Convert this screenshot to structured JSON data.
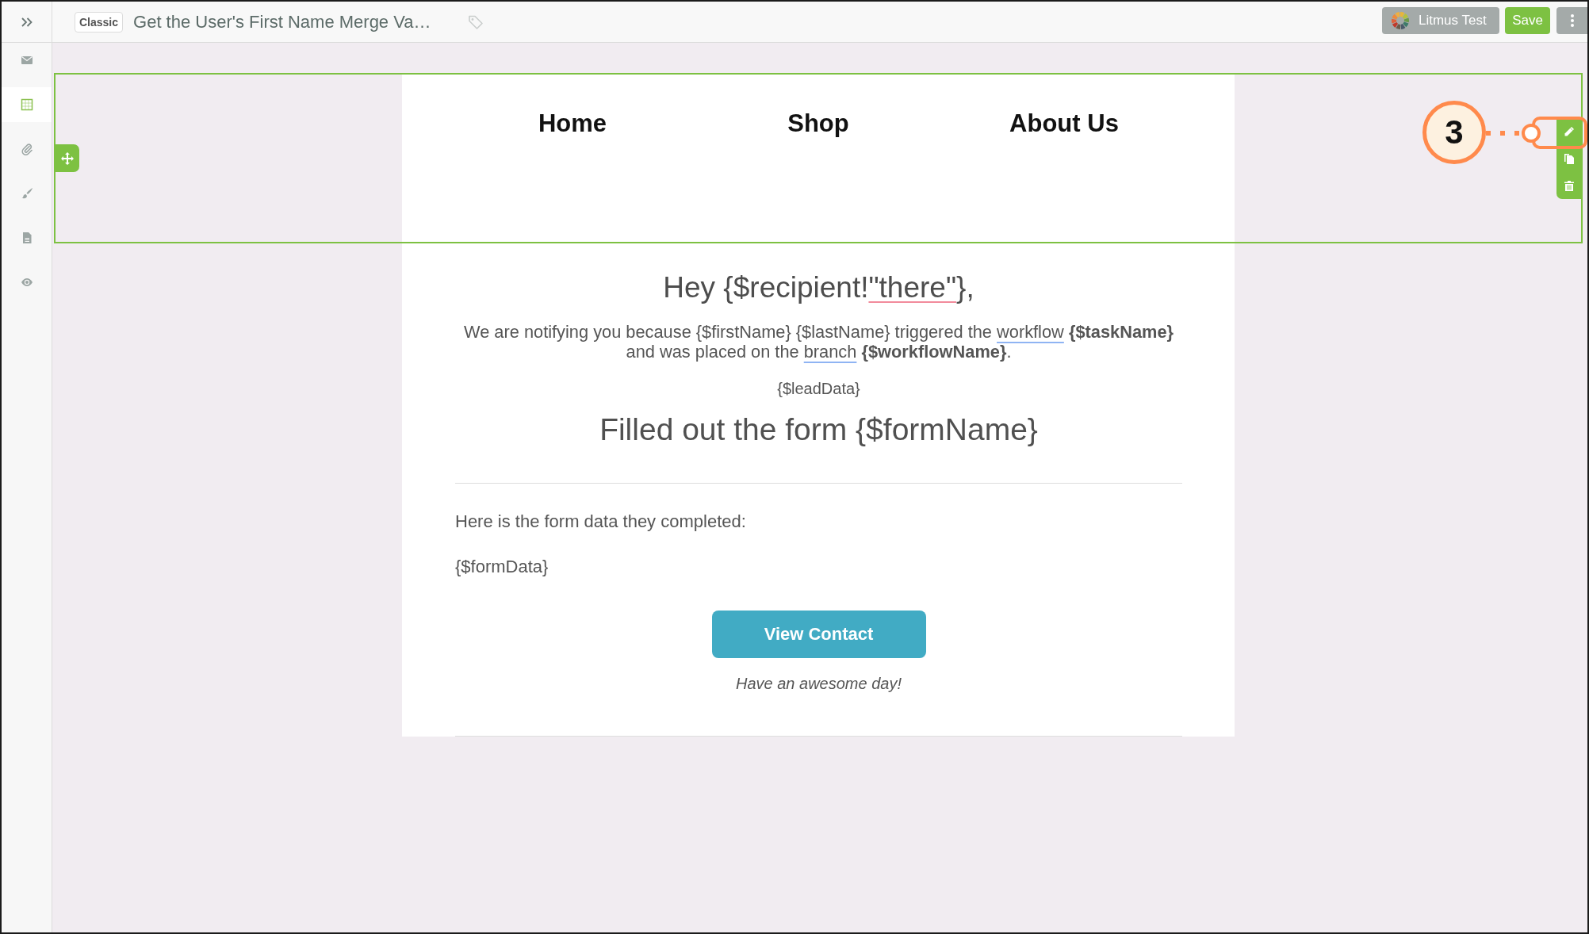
{
  "top_bar": {
    "mode_badge": "Classic",
    "title": "Get the User's First Name Merge Va…",
    "buttons": [
      {
        "kind": "litmus",
        "label": "Litmus Test"
      },
      {
        "kind": "save",
        "label": "Save"
      }
    ]
  },
  "sidebar": {
    "items": [
      {
        "selected": false
      },
      {
        "selected": true
      },
      {
        "selected": false
      },
      {
        "selected": false
      },
      {
        "selected": false
      },
      {
        "selected": false
      }
    ]
  },
  "email": {
    "header": {
      "selected": true,
      "links": [
        "Home",
        "Shop",
        "About Us"
      ]
    },
    "body": {
      "greeting": [
        {
          "kind": "plain",
          "text": "Hey {$recipient!"
        },
        {
          "kind": "misspelled",
          "text": "\"there\""
        },
        {
          "kind": "plain",
          "text": "},"
        }
      ],
      "notice": [
        {
          "kind": "plain",
          "text": "We are notifying you because {$firstName} {$lastName} triggered the "
        },
        {
          "kind": "suggestion",
          "text": "workflow"
        },
        {
          "kind": "plain",
          "text": " **{$taskName}** and was placed on the "
        },
        {
          "kind": "suggestion",
          "text": "branch"
        },
        {
          "kind": "plain",
          "text": " **{$workflowName}**."
        }
      ],
      "lead_data": "{$leadData}",
      "heading": "Filled out the form {$formName}",
      "form_intro": "Here is the form data they completed:",
      "form_data": "{$formData}",
      "button": "View Contact",
      "sign_off": "Have an awesome day!"
    }
  },
  "annotation": {
    "step": "3"
  }
}
